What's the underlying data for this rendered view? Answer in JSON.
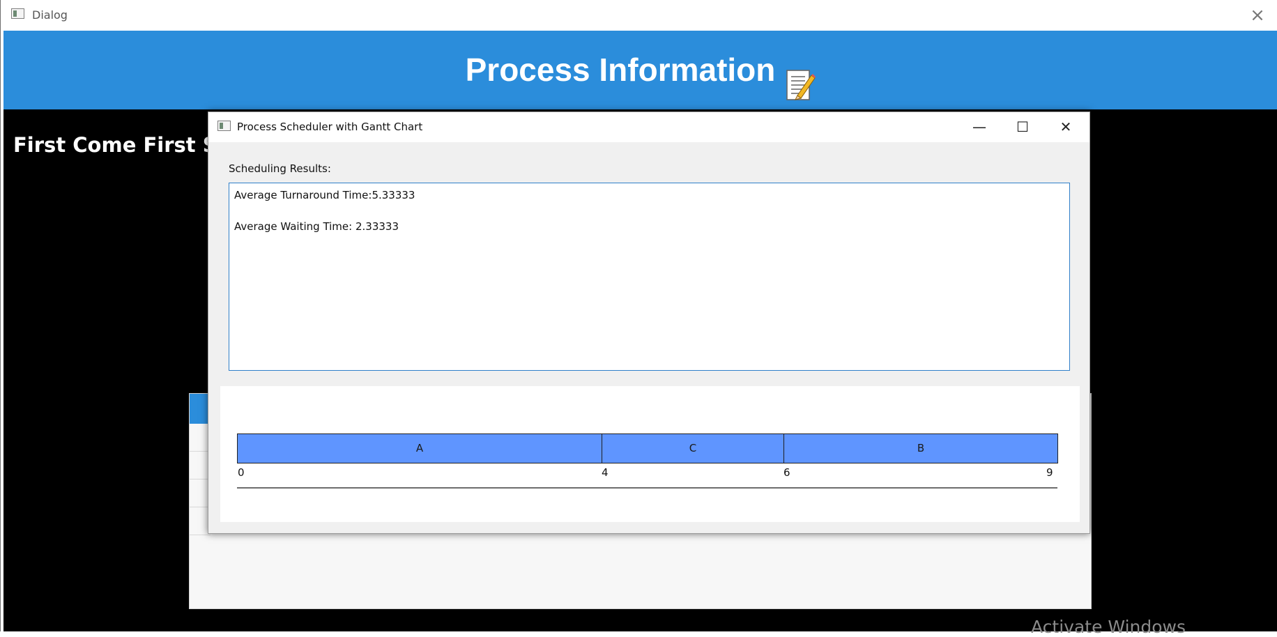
{
  "outer_window": {
    "title": "Dialog",
    "close_glyph": "×",
    "banner_title": "Process Information",
    "banner_icon": "memo-icon",
    "algorithm_heading": "First Come First Se"
  },
  "inner_window": {
    "title": "Process Scheduler with Gantt Chart",
    "minimize_glyph": "—",
    "maximize_glyph": "☐",
    "close_glyph": "✕",
    "results_label": "Scheduling Results:",
    "results_lines": [
      "Average Turnaround Time:5.33333",
      "Average Waiting Time: 2.33333"
    ]
  },
  "gantt": {
    "blocks": [
      {
        "label": "A",
        "start": 0,
        "end": 4
      },
      {
        "label": "C",
        "start": 4,
        "end": 6
      },
      {
        "label": "B",
        "start": 6,
        "end": 9
      }
    ],
    "ticks": [
      "0",
      "4",
      "6",
      "9"
    ],
    "block_color": "#5f95ff"
  },
  "watermark": "Activate Windows",
  "colors": {
    "banner": "#2b8ddb",
    "background": "#000000",
    "results_border": "#2f7fc9"
  }
}
